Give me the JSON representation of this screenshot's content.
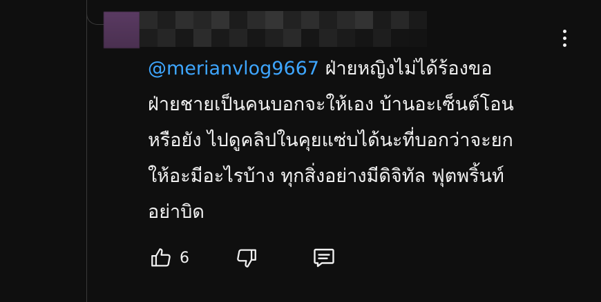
{
  "comment": {
    "mention": "@merianvlog9667",
    "text_lines": [
      "ฝ่ายหญิงไม่ได้ร้องขอ",
      "ฝ่ายชายเป็นคนบอกจะให้เอง บ้านอะเซ็นต์โอน",
      "หรือยัง ไปดูคลิปในคุยแซ่บได้นะที่บอกว่าจะยก",
      "ให้อะมีอะไรบ้าง ทุกสิ่งอย่างมีดิจิทัล ฟุตพริ้นท์",
      "อย่าบิด"
    ]
  },
  "actions": {
    "like_count": "6",
    "like_icon": "thumbs-up-icon",
    "dislike_icon": "thumbs-down-icon",
    "reply_icon": "comment-icon",
    "more_icon": "more-vertical-icon"
  },
  "colors": {
    "background": "#0f0f0f",
    "text": "#f1f1f1",
    "mention": "#3ea6ff"
  }
}
